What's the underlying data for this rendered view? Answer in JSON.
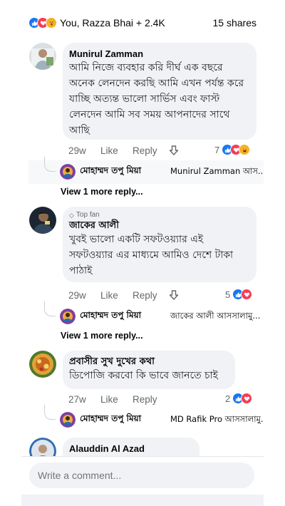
{
  "summary": {
    "reactions": [
      "like-icon",
      "love-icon",
      "wow-icon"
    ],
    "people": "You, Razza Bhai + 2.4K",
    "shares": "15 shares"
  },
  "comments": [
    {
      "author": "Munirul Zamman",
      "text": "আমি নিজে ব্যবহার করি দীর্ঘ এক বছরে অনেক লেনদেন করছি আমি এখন পর্যন্ত করে যাচ্ছি অত্যন্ত ভালো সার্ভিস এবং ফাস্ট লেনদেন আমি সব সময় আপনাদের সাথে আছি",
      "time": "29w",
      "like": "Like",
      "reply": "Reply",
      "reaction_count": "7",
      "reactions": [
        "like-icon",
        "love-icon",
        "haha-icon"
      ],
      "reply_preview": {
        "name": "মোহাম্মদ তপু মিয়া",
        "text": "Munirul Zamman আস..."
      },
      "more_replies": "View 1 more reply..."
    },
    {
      "top_fan": "Top fan",
      "author": "জাকের আলী",
      "text": "খুবই ভালো একটি সফটওয়্যার এই সফটওয়্যার এর মাধ্যমে আমিও দেশে টাকা পাঠাই",
      "time": "29w",
      "like": "Like",
      "reply": "Reply",
      "reaction_count": "5",
      "reactions": [
        "like-icon",
        "love-icon"
      ],
      "reply_preview": {
        "name": "মোহাম্মদ তপু মিয়া",
        "text": "জাকের আলী আসসালামু..."
      },
      "more_replies": "View 1 more reply..."
    },
    {
      "author": "প্রবাসীর সুখ দুখের কথা",
      "text": "ডিপোজি করবো কি ভাবে জানতে চাই",
      "time": "27w",
      "like": "Like",
      "reply": "Reply",
      "reaction_count": "2",
      "reactions": [
        "like-icon",
        "love-icon"
      ],
      "reply_preview": {
        "name": "মোহাম্মদ তপু মিয়া",
        "text": "MD Rafik Pro আসসালামু..."
      }
    },
    {
      "author": "Alauddin Al Azad"
    }
  ],
  "composer": {
    "placeholder": "Write a comment..."
  }
}
